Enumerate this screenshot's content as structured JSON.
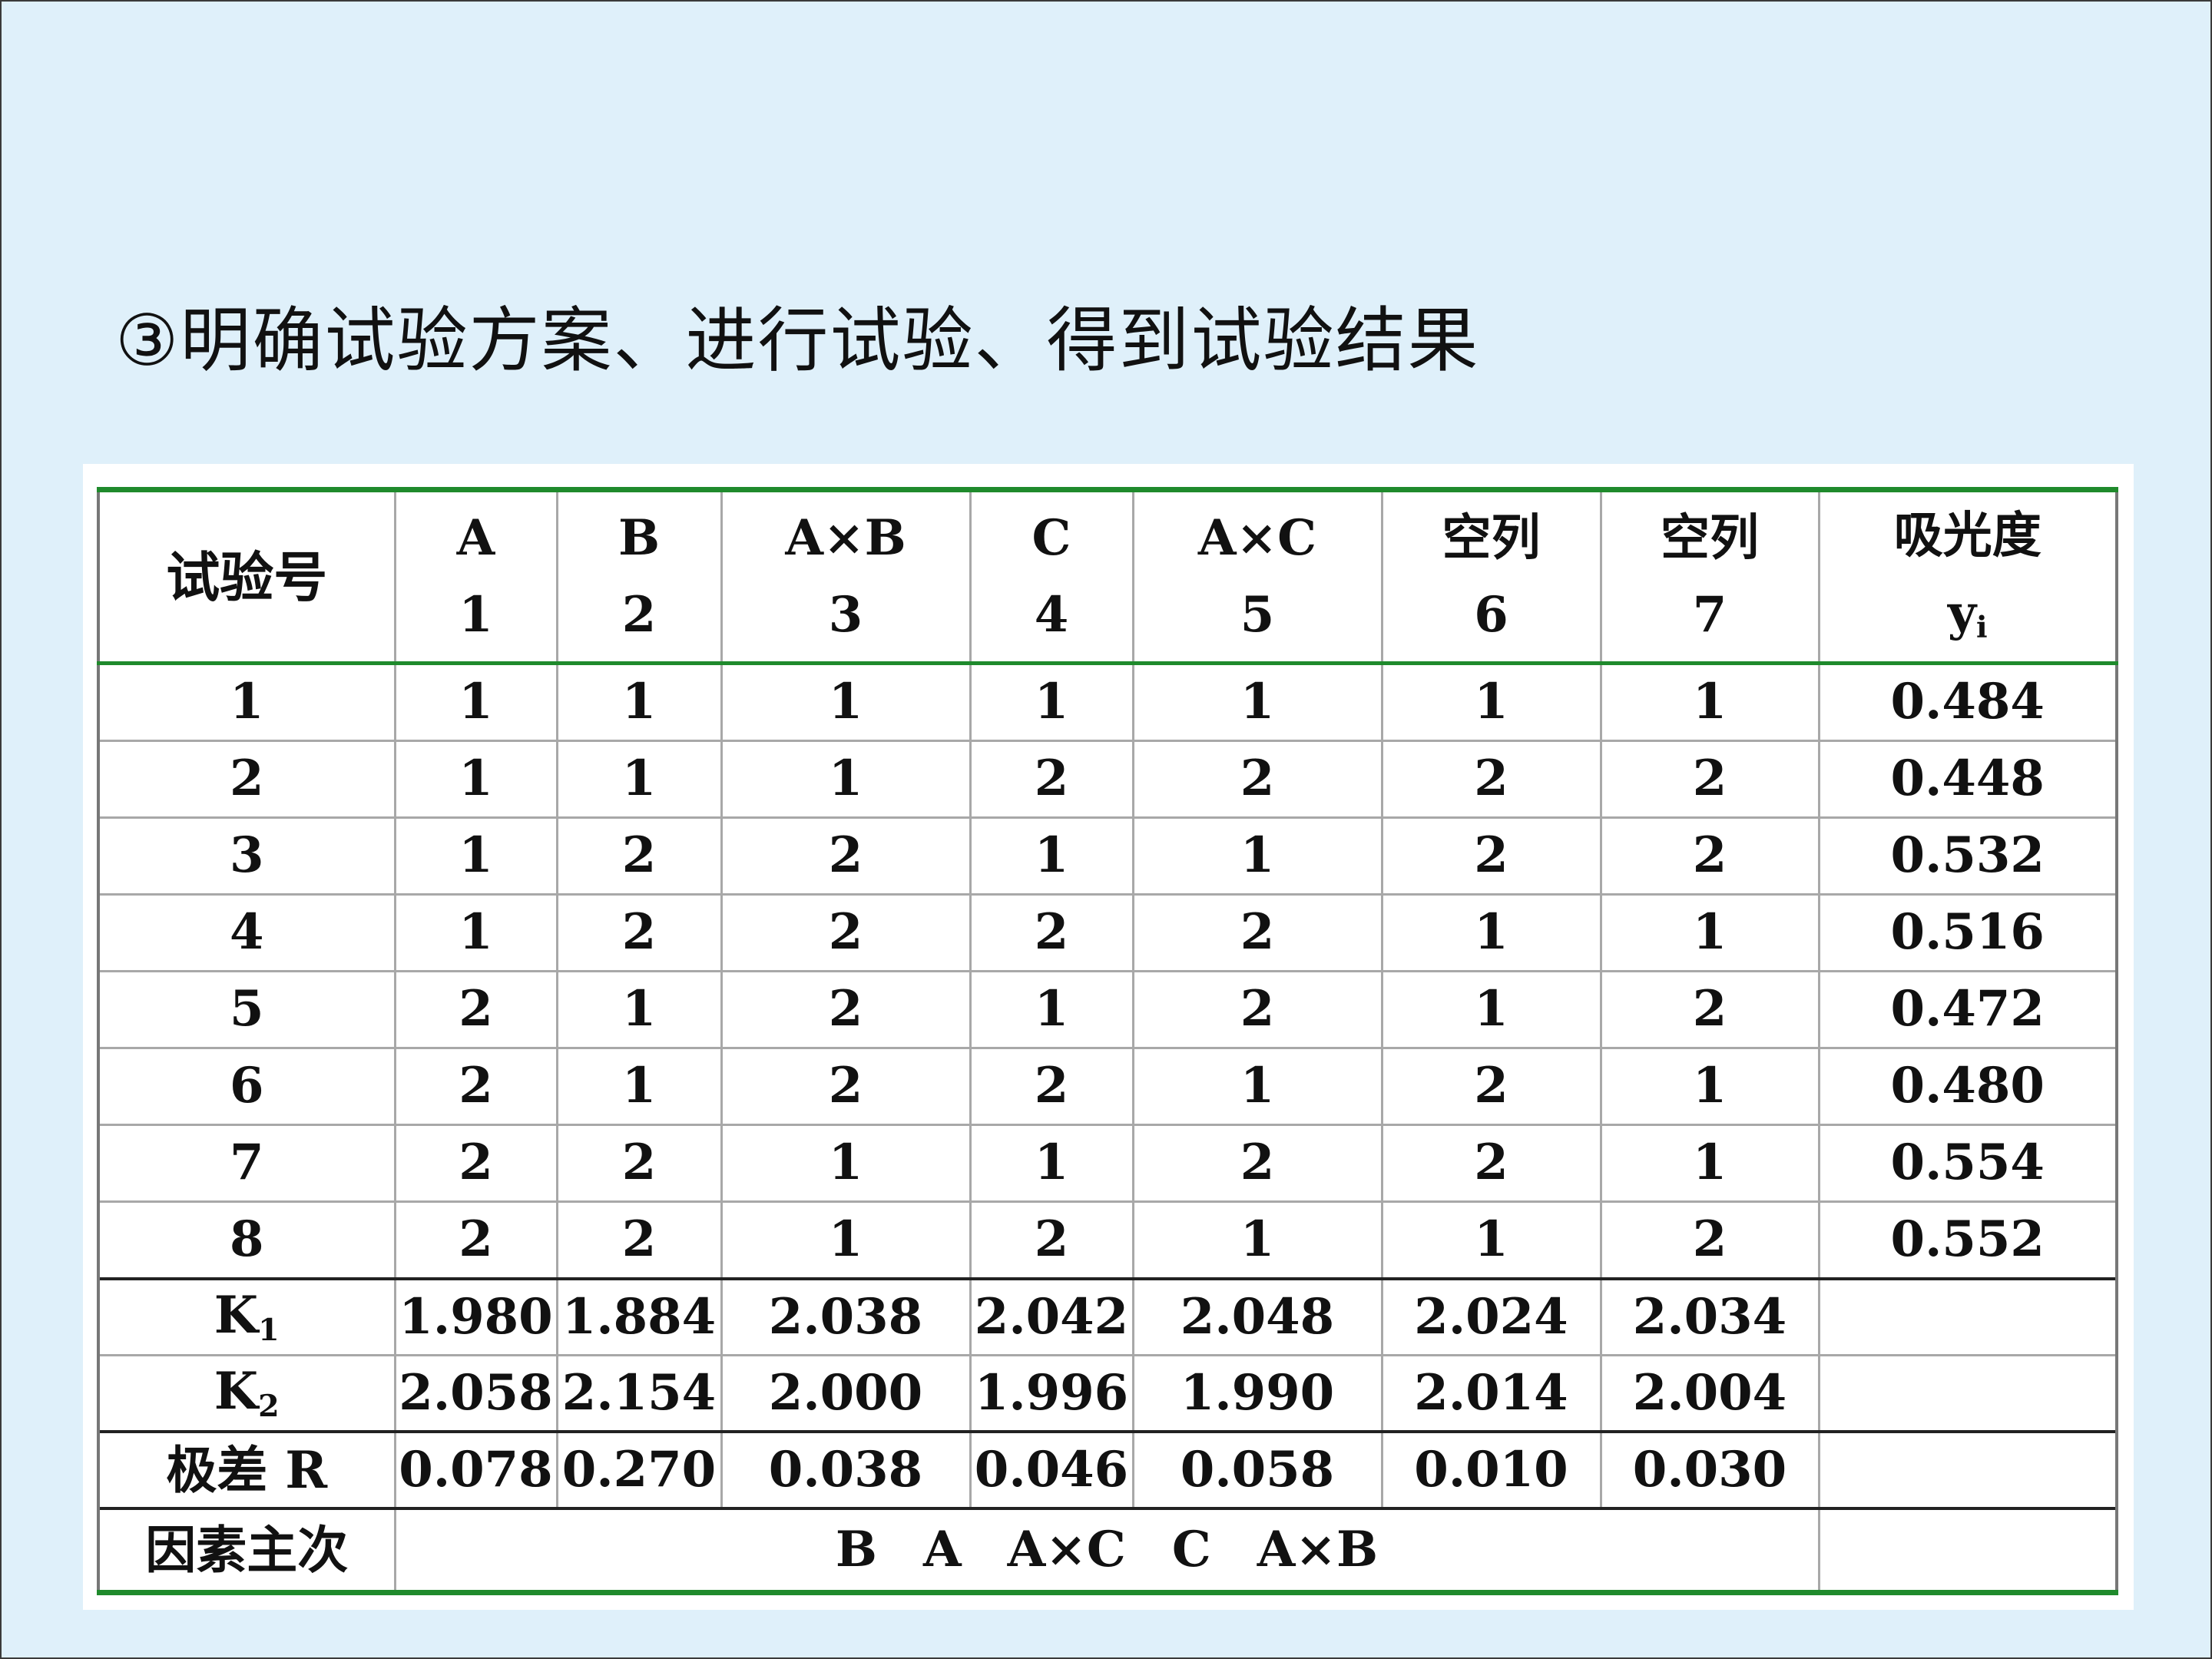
{
  "title": "③明确试验方案、进行试验、得到试验结果",
  "table": {
    "header": {
      "row_label": "试验号",
      "columns": [
        {
          "name": "A",
          "number": "1"
        },
        {
          "name": "B",
          "number": "2"
        },
        {
          "name": "A×B",
          "number": "3"
        },
        {
          "name": "C",
          "number": "4"
        },
        {
          "name": "A×C",
          "number": "5"
        },
        {
          "name": "空列",
          "number": "6"
        },
        {
          "name": "空列",
          "number": "7"
        }
      ],
      "result_name": "吸光度",
      "result_symbol": "y",
      "result_subscript": "i"
    },
    "rows": [
      {
        "id": "1",
        "levels": [
          "1",
          "1",
          "1",
          "1",
          "1",
          "1",
          "1"
        ],
        "y": "0.484"
      },
      {
        "id": "2",
        "levels": [
          "1",
          "1",
          "1",
          "2",
          "2",
          "2",
          "2"
        ],
        "y": "0.448"
      },
      {
        "id": "3",
        "levels": [
          "1",
          "2",
          "2",
          "1",
          "1",
          "2",
          "2"
        ],
        "y": "0.532"
      },
      {
        "id": "4",
        "levels": [
          "1",
          "2",
          "2",
          "2",
          "2",
          "1",
          "1"
        ],
        "y": "0.516"
      },
      {
        "id": "5",
        "levels": [
          "2",
          "1",
          "2",
          "1",
          "2",
          "1",
          "2"
        ],
        "y": "0.472"
      },
      {
        "id": "6",
        "levels": [
          "2",
          "1",
          "2",
          "2",
          "1",
          "2",
          "1"
        ],
        "y": "0.480"
      },
      {
        "id": "7",
        "levels": [
          "2",
          "2",
          "1",
          "1",
          "2",
          "2",
          "1"
        ],
        "y": "0.554"
      },
      {
        "id": "8",
        "levels": [
          "2",
          "2",
          "1",
          "2",
          "1",
          "1",
          "2"
        ],
        "y": "0.552"
      }
    ],
    "k1": {
      "label": "K",
      "sub": "1",
      "values": [
        "1.980",
        "1.884",
        "2.038",
        "2.042",
        "2.048",
        "2.024",
        "2.034"
      ]
    },
    "k2": {
      "label": "K",
      "sub": "2",
      "values": [
        "2.058",
        "2.154",
        "2.000",
        "1.996",
        "1.990",
        "2.014",
        "2.004"
      ]
    },
    "range": {
      "label": "极差 R",
      "values": [
        "0.078",
        "0.270",
        "0.038",
        "0.046",
        "0.058",
        "0.010",
        "0.030"
      ]
    },
    "factor_order": {
      "label": "因素主次",
      "sequence": [
        "B",
        "A",
        "A×C",
        "C",
        "A×B"
      ]
    }
  }
}
